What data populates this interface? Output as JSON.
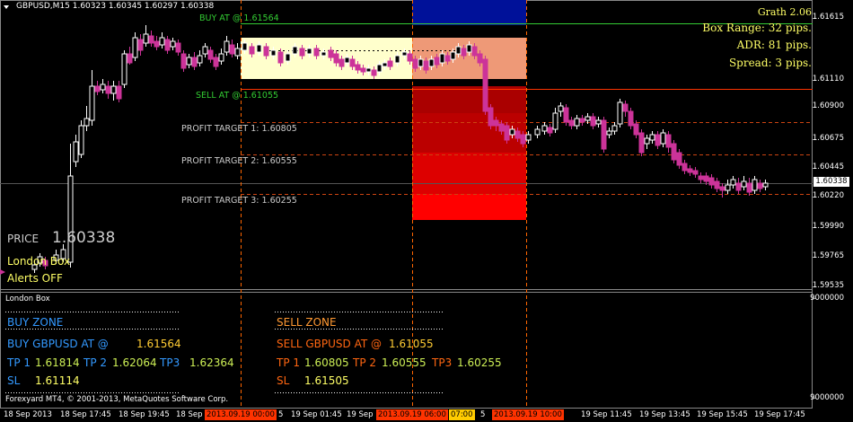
{
  "header": {
    "symbol_info": "GBPUSD,M15  1.60323 1.60345 1.60297 1.60338"
  },
  "levels": {
    "buy_at": "BUY AT @ 1.61564",
    "sell_at": "SELL AT @ 1.61055",
    "profit_target_1": "PROFIT TARGET 1: 1.60805",
    "profit_target_2": "PROFIT TARGET 2: 1.60555",
    "profit_target_3": "PROFIT TARGET 3: 1.60255"
  },
  "info_box": {
    "title": "Grath 2.06",
    "box_range": "Box Range: 32 pips.",
    "adr": "ADR: 81 pips.",
    "spread": "Spread: 3 pips."
  },
  "overlay": {
    "price_label": "PRICE",
    "price_value": "1.60338",
    "london_box": "London Box",
    "alerts": "Alerts OFF"
  },
  "price_axis": {
    "ticks": [
      "1.61615",
      "1.61110",
      "1.60900",
      "1.60675",
      "1.60445",
      "1.60220",
      "1.59990",
      "1.59765",
      "1.59535"
    ],
    "current": "1.60338"
  },
  "indicator_panel": {
    "title": "London Box",
    "axis_top": "9000000",
    "axis_bottom": "9000000",
    "buy_zone": "BUY ZONE",
    "buy_at": "BUY GBPUSD AT @",
    "buy_price": "1.61564",
    "buy_tp1_label": "TP 1",
    "buy_tp1": "1.61814",
    "buy_tp2_label": "TP 2",
    "buy_tp2": "1.62064",
    "buy_tp3_label": "TP3",
    "buy_tp3": "1.62364",
    "buy_sl_label": "SL",
    "buy_sl": "1.61114",
    "sell_zone": "SELL ZONE",
    "sell_at": "SELL GBPUSD AT @",
    "sell_price": "1.61055",
    "sell_tp1_label": "TP 1",
    "sell_tp1": "1.60805",
    "sell_tp2_label": "TP 2",
    "sell_tp2": "1.60555",
    "sell_tp3_label": "TP3",
    "sell_tp3": "1.60255",
    "sell_sl_label": "SL",
    "sell_sl": "1.61505",
    "copyright": "Forexyard MT4, © 2001-2013, MetaQuotes Software Corp."
  },
  "time_axis": {
    "labels": [
      "18 Sep 2013",
      "18 Sep 17:45",
      "18 Sep 19:45",
      "18 Sep",
      "5",
      "19 Sep 01:45",
      "19 Sep",
      "5",
      "19 Sep 11:45",
      "19 Sep 13:45",
      "19 Sep 15:45",
      "19 Sep 17:45"
    ],
    "highlight_1": "2013.09.19 00:00",
    "highlight_2": "2013.09.19 06:00",
    "highlight_3": "07:00",
    "highlight_4": "2013.09.19 10:00"
  },
  "colors": {
    "background": "#000000",
    "bull": "#ffffff",
    "bear": "#cc3399",
    "buy_line": "#33cc33",
    "sell_line": "#ff3300",
    "target_line": "#cc4411",
    "session_line": "#ff6600",
    "box_light": "#ffffcc",
    "box_salmon": "#ee9977",
    "bar_blue": "#001199",
    "info_text": "#ffff66",
    "buy_text": "#3399ff",
    "sell_text": "#ff6611",
    "tp_text": "#ccee55"
  }
}
